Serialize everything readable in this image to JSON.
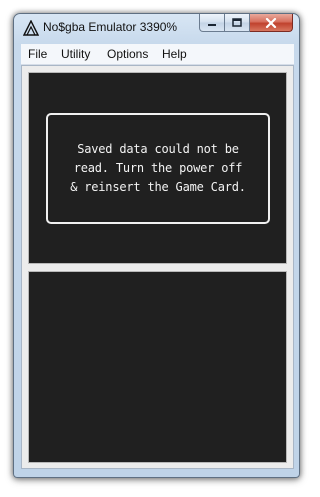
{
  "window": {
    "title": "No$gba Emulator 3390%",
    "icon": "no-gba-a-logo-icon"
  },
  "caption_buttons": {
    "minimize_icon": "minimize-icon",
    "maximize_icon": "maximize-icon",
    "close_icon": "close-icon"
  },
  "menu": {
    "items": [
      {
        "label": "File"
      },
      {
        "label": "Utility"
      },
      {
        "label": "Options"
      },
      {
        "label": "Help"
      }
    ]
  },
  "top_screen": {
    "message": "Saved data could not be\nread. Turn the power off\n& reinsert the Game Card."
  },
  "colors": {
    "screen_background": "#202020",
    "dialog_border": "#f0f0f0",
    "dialog_text": "#f3f3f3",
    "close_button": "#c0422e"
  }
}
